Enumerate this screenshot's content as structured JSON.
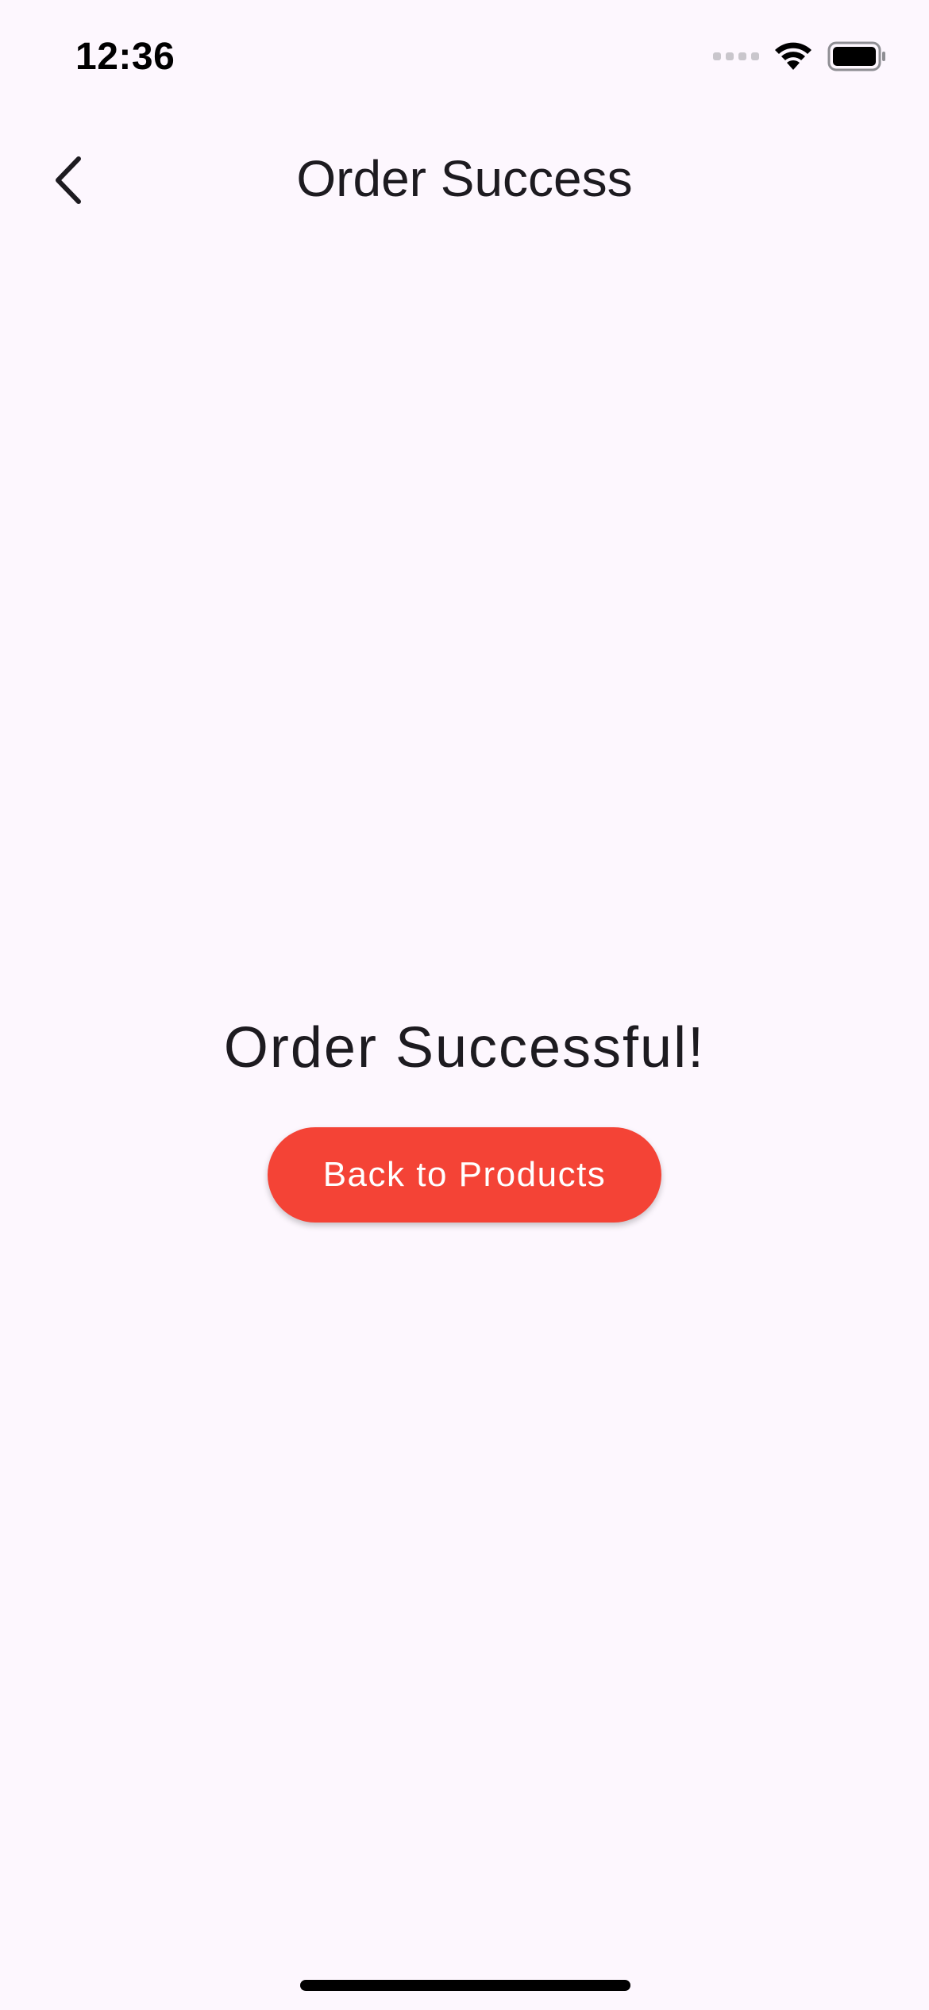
{
  "status_bar": {
    "time": "12:36",
    "icons": [
      "cellular-signal-icon",
      "wifi-icon",
      "battery-icon"
    ]
  },
  "app_bar": {
    "back_icon": "chevron-left-icon",
    "title": "Order Success"
  },
  "main": {
    "message": "Order Successful!",
    "button_label": "Back to Products"
  },
  "colors": {
    "background": "#fdf7fe",
    "accent": "#f44336",
    "text": "#1d1b20"
  }
}
